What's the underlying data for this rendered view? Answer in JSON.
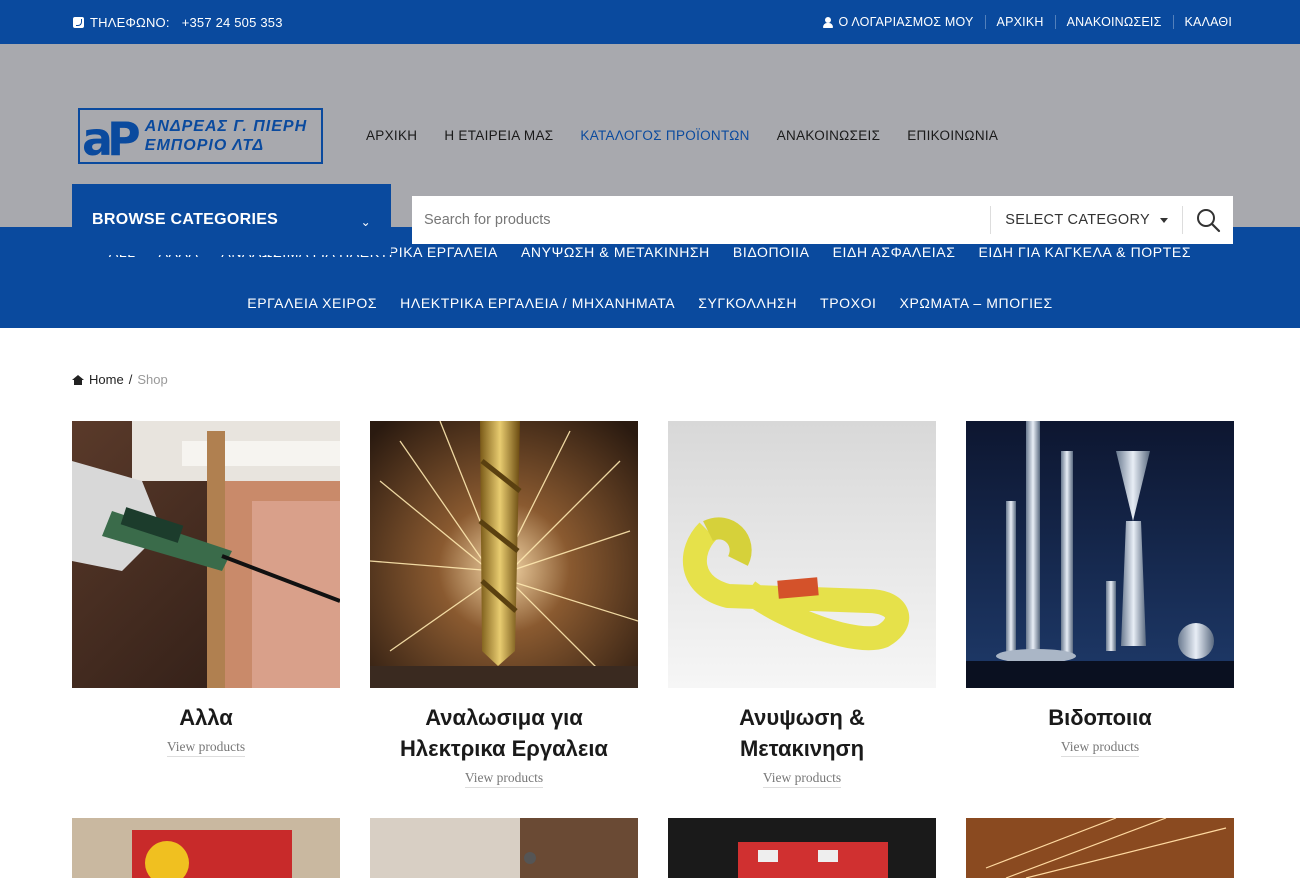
{
  "topbar": {
    "phone_label": "ΤΗΛΕΦΩΝΟ:",
    "phone_number": "+357 24 505 353",
    "links": [
      "Ο ΛΟΓΑΡΙΑΣΜΟΣ ΜΟΥ",
      "ΑΡΧΙΚΗ",
      "ΑΝΑΚΟΙΝΩΣΕΙΣ",
      "ΚΑΛΑΘΙ"
    ]
  },
  "logo": {
    "mark": "aP",
    "line1": "ΑΝΔΡΕΑΣ Γ. ΠΙΕΡΗ",
    "line2": "ΕΜΠΟΡΙΟ ΛΤΔ"
  },
  "mainnav": {
    "items": [
      "ΑΡΧΙΚΗ",
      "Η ΕΤΑΙΡΕΙΑ ΜΑΣ",
      "ΚΑΤΑΛΟΓΟΣ ΠΡΟΪΟΝΤΩΝ",
      "ΑΝΑΚΟΙΝΩΣΕΙΣ",
      "ΕΠΙΚΟΙΝΩΝΙΑ"
    ],
    "active_index": 2
  },
  "browse": {
    "label": "BROWSE CATEGORIES",
    "chevron": "⌄"
  },
  "search": {
    "placeholder": "Search for products",
    "category_label": "SELECT CATEGORY"
  },
  "categories": {
    "row1": [
      "ALL",
      "ΑΛΛΑ",
      "ΑΝΑΛΩΣΙΜΑ ΓΙΑ ΗΛΕΚΤΡΙΚΑ ΕΡΓΑΛΕΙΑ",
      "ΑΝΥΨΩΣΗ & ΜΕΤΑΚΙΝΗΣΗ",
      "ΒΙΔΟΠΟΙΙΑ",
      "ΕΙΔΗ ΑΣΦΑΛΕΙΑΣ",
      "ΕΙΔΗ ΓΙΑ ΚΑΓΚΕΛΑ & ΠΟΡΤΕΣ"
    ],
    "row2": [
      "ΕΡΓΑΛΕΙΑ ΧΕΙΡΟΣ",
      "ΗΛΕΚΤΡΙΚΑ ΕΡΓΑΛΕΙΑ / ΜΗΧΑΝΗΜΑΤΑ",
      "ΣΥΓΚΟΛΛΗΣΗ",
      "ΤΡΟΧΟΙ",
      "ΧΡΩΜΑΤΑ – ΜΠΟΓΙΕΣ"
    ]
  },
  "breadcrumb": {
    "home": "Home",
    "separator": "/",
    "current": "Shop"
  },
  "products": [
    {
      "title": "Αλλα",
      "link": "View products",
      "image": "caulking-gun-photo"
    },
    {
      "title": "Αναλωσιμα για Ηλεκτρικα Εργαλεια",
      "link": "View products",
      "image": "drill-bit-sparks-photo"
    },
    {
      "title": "Ανυψωση & Μετακινηση",
      "link": "View products",
      "image": "lifting-sling-photo"
    },
    {
      "title": "Βιδοποιια",
      "link": "View products",
      "image": "screws-photo"
    }
  ],
  "colors": {
    "brand_blue": "#0a4a9e",
    "header_gray": "#a8a9ae"
  }
}
